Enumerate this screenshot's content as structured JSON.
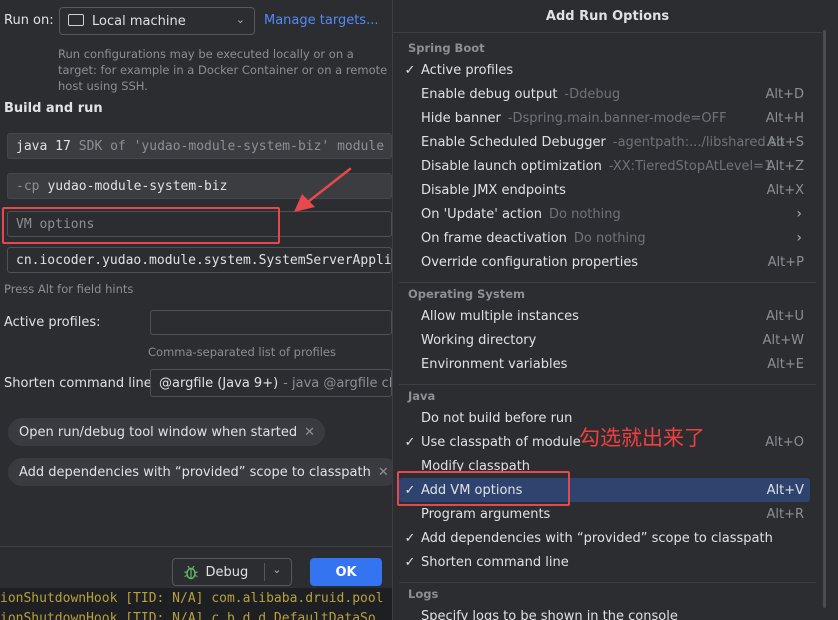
{
  "left_panel": {
    "run_on_label": "Run on:",
    "run_target": "Local machine",
    "manage_targets": "Manage targets...",
    "run_on_hint": "Run configurations may be executed locally or on a target: for example in a Docker Container or on a remote host using SSH.",
    "build_run_title": "Build and run",
    "sdk_java": "java 17",
    "sdk_desc": "SDK of 'yudao-module-system-biz' module",
    "cp_flag": "-cp",
    "cp_module": "yudao-module-system-biz",
    "vm_options_placeholder": "VM options",
    "main_class": "cn.iocoder.yudao.module.system.SystemServerApplication",
    "field_hints": "Press Alt for field hints",
    "active_profiles_label": "Active profiles:",
    "active_profiles_value": "",
    "profiles_hint": "Comma-separated list of profiles",
    "shorten_label": "Shorten command line:",
    "shorten_value": "@argfile (Java 9+)",
    "shorten_desc": "- java @argfile className",
    "chip_open_window": "Open run/debug tool window when started",
    "chip_add_deps": "Add dependencies with “provided” scope to classpath",
    "debug_button": "Debug",
    "ok_button": "OK",
    "console_line1": "ionShutdownHook [TID: N/A] com.alibaba.druid.pool",
    "console_line2": "ionShutdownHook [TID: N/A] c.b.d.d.DefaultDataSo"
  },
  "popup": {
    "title": "Add Run Options",
    "annotation": "勾选就出来了",
    "sections": [
      {
        "name": "Spring Boot",
        "items": [
          {
            "check": "✓",
            "label": "Active profiles",
            "desc": "",
            "shortcut": "",
            "arrow": ""
          },
          {
            "check": "",
            "label": "Enable debug output",
            "desc": "-Ddebug",
            "shortcut": "Alt+D",
            "arrow": ""
          },
          {
            "check": "",
            "label": "Hide banner",
            "desc": "-Dspring.main.banner-mode=OFF",
            "shortcut": "Alt+H",
            "arrow": ""
          },
          {
            "check": "",
            "label": "Enable Scheduled Debugger",
            "desc": "-agentpath:.../libshared.so",
            "shortcut": "Alt+S",
            "arrow": ""
          },
          {
            "check": "",
            "label": "Disable launch optimization",
            "desc": "-XX:TieredStopAtLevel=1",
            "shortcut": "Alt+Z",
            "arrow": ""
          },
          {
            "check": "",
            "label": "Disable JMX endpoints",
            "desc": "",
            "shortcut": "Alt+X",
            "arrow": ""
          },
          {
            "check": "",
            "label": "On 'Update' action",
            "desc": "Do nothing",
            "shortcut": "",
            "arrow": "›"
          },
          {
            "check": "",
            "label": "On frame deactivation",
            "desc": "Do nothing",
            "shortcut": "",
            "arrow": "›"
          },
          {
            "check": "",
            "label": "Override configuration properties",
            "desc": "",
            "shortcut": "Alt+P",
            "arrow": ""
          }
        ]
      },
      {
        "name": "Operating System",
        "items": [
          {
            "check": "",
            "label": "Allow multiple instances",
            "desc": "",
            "shortcut": "Alt+U",
            "arrow": ""
          },
          {
            "check": "",
            "label": "Working directory",
            "desc": "",
            "shortcut": "Alt+W",
            "arrow": ""
          },
          {
            "check": "",
            "label": "Environment variables",
            "desc": "",
            "shortcut": "Alt+E",
            "arrow": ""
          }
        ]
      },
      {
        "name": "Java",
        "items": [
          {
            "check": "",
            "label": "Do not build before run",
            "desc": "",
            "shortcut": "",
            "arrow": ""
          },
          {
            "check": "✓",
            "label": "Use classpath of module",
            "desc": "",
            "shortcut": "Alt+O",
            "arrow": ""
          },
          {
            "check": "",
            "label": "Modify classpath",
            "desc": "",
            "shortcut": "",
            "arrow": ""
          },
          {
            "check": "✓",
            "label": "Add VM options",
            "desc": "",
            "shortcut": "Alt+V",
            "arrow": "",
            "selected": true
          },
          {
            "check": "",
            "label": "Program arguments",
            "desc": "",
            "shortcut": "Alt+R",
            "arrow": ""
          },
          {
            "check": "✓",
            "label": "Add dependencies with “provided” scope to classpath",
            "desc": "",
            "shortcut": "",
            "arrow": ""
          },
          {
            "check": "✓",
            "label": "Shorten command line",
            "desc": "",
            "shortcut": "",
            "arrow": ""
          }
        ]
      },
      {
        "name": "Logs",
        "items": [
          {
            "check": "",
            "label": "Specify logs to be shown in the console",
            "desc": "",
            "shortcut": "",
            "arrow": ""
          }
        ]
      }
    ]
  },
  "colors": {
    "background": "#2b2d30",
    "selection": "#2e436e",
    "primary_button": "#3574f0",
    "highlight_red": "#e5484d",
    "link": "#548af7"
  }
}
